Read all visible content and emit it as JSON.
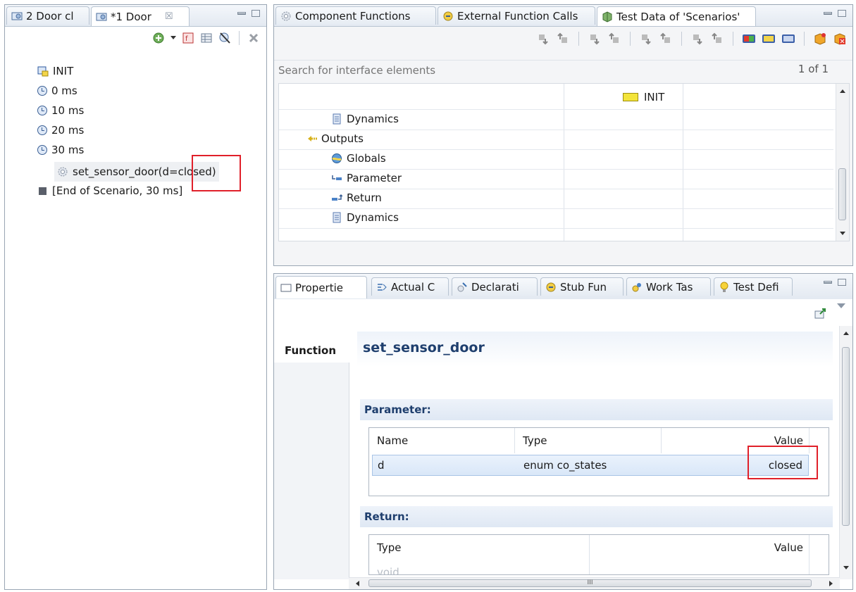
{
  "left_pane": {
    "tabs": [
      {
        "label": "2 Door cl",
        "icon": "scenario-icon"
      },
      {
        "label": "*1 Door",
        "icon": "scenario-icon",
        "close": "☒"
      }
    ],
    "tree": [
      {
        "label": "INIT",
        "icon": "init-icon"
      },
      {
        "label": "0 ms",
        "icon": "clock-icon"
      },
      {
        "label": "10 ms",
        "icon": "clock-icon"
      },
      {
        "label": "20 ms",
        "icon": "clock-icon"
      },
      {
        "label": "30 ms",
        "icon": "clock-icon"
      },
      {
        "label": "set_sensor_door(d=closed)",
        "icon": "gear-icon"
      },
      {
        "label": "[End of Scenario, 30 ms]",
        "icon": "end-marker-icon"
      }
    ]
  },
  "top_right_pane": {
    "tabs": [
      {
        "label": "Component Functions",
        "icon": "gear-icon"
      },
      {
        "label": "External Function Calls",
        "icon": "external-call-icon"
      },
      {
        "label": "Test Data of 'Scenarios'",
        "icon": "test-data-icon"
      }
    ],
    "search": {
      "placeholder": "Search for interface elements",
      "count": "1 of 1"
    },
    "grid": {
      "column_header": "INIT",
      "rows": [
        {
          "label": "Dynamics",
          "icon": "dynamics-icon",
          "indent": 2
        },
        {
          "label": "Outputs",
          "icon": "outputs-icon",
          "indent": 1
        },
        {
          "label": "Globals",
          "icon": "globals-icon",
          "indent": 2
        },
        {
          "label": "Parameter",
          "icon": "parameter-icon",
          "indent": 2
        },
        {
          "label": "Return",
          "icon": "return-icon",
          "indent": 2
        },
        {
          "label": "Dynamics",
          "icon": "dynamics-icon",
          "indent": 2
        }
      ]
    }
  },
  "bottom_right_pane": {
    "tabs": [
      {
        "label": "Propertie",
        "icon": "properties-icon"
      },
      {
        "label": "Actual C",
        "icon": "actual-call-icon"
      },
      {
        "label": "Declarati",
        "icon": "declaration-icon"
      },
      {
        "label": "Stub Fun",
        "icon": "stub-function-icon"
      },
      {
        "label": "Work Tas",
        "icon": "work-task-icon"
      },
      {
        "label": "Test Defi",
        "icon": "lightbulb-icon"
      }
    ],
    "side_tab": "Function",
    "function_name": "set_sensor_door",
    "parameter": {
      "header": "Parameter:",
      "columns": [
        "Name",
        "Type",
        "Value"
      ],
      "rows": [
        {
          "name": "d",
          "type": "enum co_states",
          "value": "closed"
        }
      ]
    },
    "return": {
      "header": "Return:",
      "columns": [
        "Type",
        "Value"
      ],
      "rows": [
        {
          "type": "void"
        }
      ]
    },
    "hscroll_grip": "III"
  }
}
